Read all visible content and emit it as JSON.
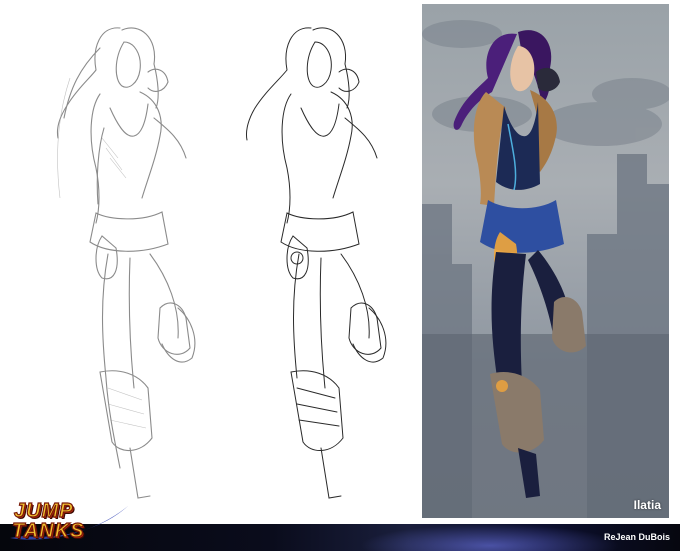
{
  "artwork": {
    "character_name": "Ilatia",
    "artist_credit": "ReJean DuBois",
    "logo": {
      "line1": "JUMP",
      "line2": "TANKS"
    },
    "colors": {
      "hair": "#4b1f7a",
      "jacket": "#b98a55",
      "bodysuit": "#1c2a55",
      "skirt": "#2e4fa1",
      "boots": "#8a7a6a",
      "accent_glow": "#f2a63a",
      "sketch_line": "#6f6f6f",
      "ink_line": "#2a2a2a",
      "background_color_panel": "#9aa2a8",
      "bottom_bar": "#0a0c1c"
    },
    "panels": [
      "pencil-sketch",
      "ink-lineart",
      "final-color"
    ]
  }
}
